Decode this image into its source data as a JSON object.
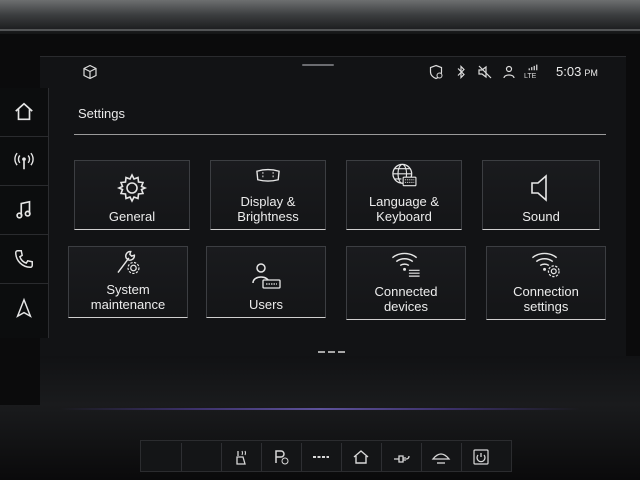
{
  "status_bar": {
    "time": "5:03",
    "ampm": "PM",
    "network_label": "LTE"
  },
  "page": {
    "title": "Settings"
  },
  "tiles": [
    {
      "label": "General",
      "icon": "gear-icon"
    },
    {
      "label": "Display & Brightness",
      "icon": "display-icon"
    },
    {
      "label": "Language & Keyboard",
      "icon": "globe-keyboard-icon"
    },
    {
      "label": "Sound",
      "icon": "speaker-icon"
    },
    {
      "label": "System maintenance",
      "icon": "wrench-gear-icon"
    },
    {
      "label": "Users",
      "icon": "user-card-icon"
    },
    {
      "label": "Connected devices",
      "icon": "wifi-list-icon"
    },
    {
      "label": "Connection settings",
      "icon": "wifi-gear-icon"
    }
  ],
  "side_nav": [
    "home-icon",
    "radio-icon",
    "music-icon",
    "phone-icon",
    "navigation-icon"
  ],
  "colors": {
    "background": "#121315",
    "tile_border": "#3c3e42",
    "text": "#ececec"
  }
}
